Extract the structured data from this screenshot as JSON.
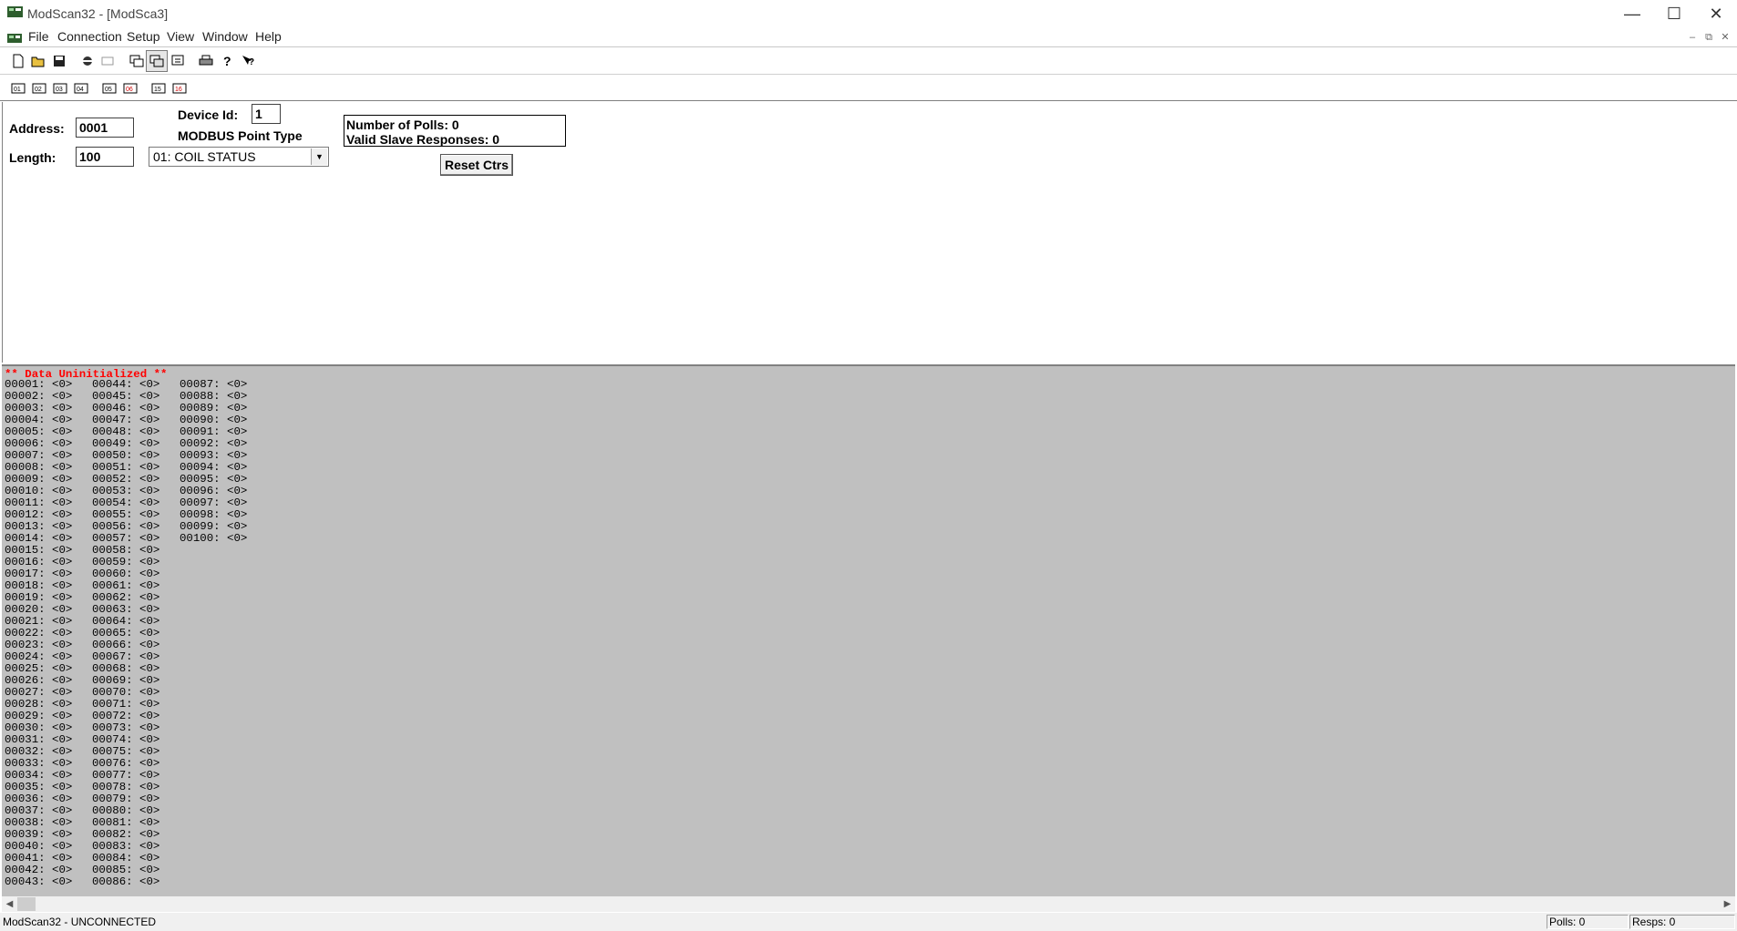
{
  "window": {
    "title": "ModScan32 - [ModSca3]"
  },
  "menu": [
    "File",
    "Connection",
    "Setup",
    "View",
    "Window",
    "Help"
  ],
  "form": {
    "address_label": "Address:",
    "address_value": "0001",
    "length_label": "Length:",
    "length_value": "100",
    "device_id_label": "Device Id:",
    "device_id_value": "1",
    "point_type_label": "MODBUS Point Type",
    "point_type_value": "01: COIL STATUS",
    "polls_text": "Number of Polls: 0",
    "responses_text": "Valid Slave Responses: 0",
    "reset_label": "Reset Ctrs"
  },
  "data": {
    "uninit_text": "** Data Uninitialized **",
    "columns": [
      [
        "00001: <0>",
        "00002: <0>",
        "00003: <0>",
        "00004: <0>",
        "00005: <0>",
        "00006: <0>",
        "00007: <0>",
        "00008: <0>",
        "00009: <0>",
        "00010: <0>",
        "00011: <0>",
        "00012: <0>",
        "00013: <0>",
        "00014: <0>",
        "00015: <0>",
        "00016: <0>",
        "00017: <0>",
        "00018: <0>",
        "00019: <0>",
        "00020: <0>",
        "00021: <0>",
        "00022: <0>",
        "00023: <0>",
        "00024: <0>",
        "00025: <0>",
        "00026: <0>",
        "00027: <0>",
        "00028: <0>",
        "00029: <0>",
        "00030: <0>",
        "00031: <0>",
        "00032: <0>",
        "00033: <0>",
        "00034: <0>",
        "00035: <0>",
        "00036: <0>",
        "00037: <0>",
        "00038: <0>",
        "00039: <0>",
        "00040: <0>",
        "00041: <0>",
        "00042: <0>",
        "00043: <0>"
      ],
      [
        "00044: <0>",
        "00045: <0>",
        "00046: <0>",
        "00047: <0>",
        "00048: <0>",
        "00049: <0>",
        "00050: <0>",
        "00051: <0>",
        "00052: <0>",
        "00053: <0>",
        "00054: <0>",
        "00055: <0>",
        "00056: <0>",
        "00057: <0>",
        "00058: <0>",
        "00059: <0>",
        "00060: <0>",
        "00061: <0>",
        "00062: <0>",
        "00063: <0>",
        "00064: <0>",
        "00065: <0>",
        "00066: <0>",
        "00067: <0>",
        "00068: <0>",
        "00069: <0>",
        "00070: <0>",
        "00071: <0>",
        "00072: <0>",
        "00073: <0>",
        "00074: <0>",
        "00075: <0>",
        "00076: <0>",
        "00077: <0>",
        "00078: <0>",
        "00079: <0>",
        "00080: <0>",
        "00081: <0>",
        "00082: <0>",
        "00083: <0>",
        "00084: <0>",
        "00085: <0>",
        "00086: <0>"
      ],
      [
        "00087: <0>",
        "00088: <0>",
        "00089: <0>",
        "00090: <0>",
        "00091: <0>",
        "00092: <0>",
        "00093: <0>",
        "00094: <0>",
        "00095: <0>",
        "00096: <0>",
        "00097: <0>",
        "00098: <0>",
        "00099: <0>",
        "00100: <0>"
      ]
    ]
  },
  "status": {
    "connection": "ModScan32 - UNCONNECTED",
    "polls": "Polls: 0",
    "resps": "Resps: 0"
  },
  "colors": {
    "data_bg": "#c0c0c0",
    "uninit_text": "#ff0000"
  }
}
